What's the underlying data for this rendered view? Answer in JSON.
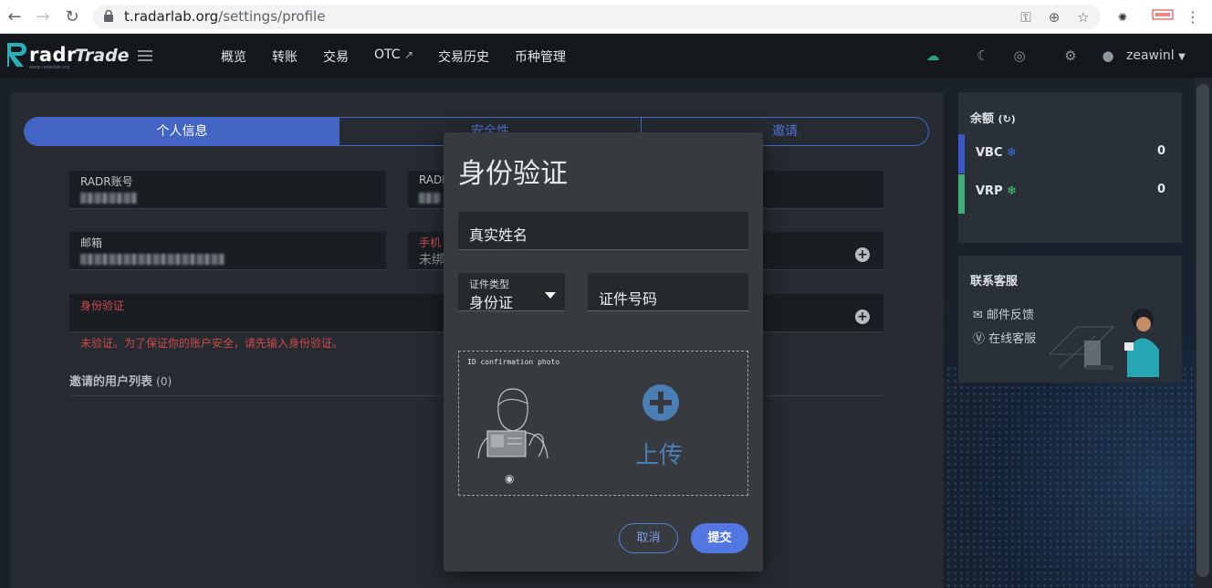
{
  "browser": {
    "url_host": "t.radarlab.org",
    "url_path": "/settings/profile"
  },
  "header": {
    "logo_word": "radr",
    "logo_trade": "Trade",
    "logo_sub": "www.radarlab.org",
    "nav": [
      "概览",
      "转账",
      "交易",
      "OTC",
      "交易历史",
      "币种管理"
    ],
    "user_name": "zeawinl"
  },
  "tabs": [
    {
      "label": "个人信息",
      "active": true
    },
    {
      "label": "安全性",
      "active": false
    },
    {
      "label": "邀请",
      "active": false
    }
  ],
  "profile": {
    "radr_account_label": "RADR账号",
    "radr_label_2": "RADR",
    "email_label": "邮箱",
    "phone_label": "手机",
    "phone_value": "未绑",
    "identity_label": "身份验证",
    "warning": "未验证。为了保证你的账户安全，请先输入身份验证。",
    "invite_title": "邀请的用户列表",
    "invite_count": "(0)"
  },
  "balance": {
    "title": "余额",
    "refresh_icon": "refresh-icon",
    "coins": [
      {
        "name": "VBC",
        "value": "0",
        "color": "#3b57c9"
      },
      {
        "name": "VRP",
        "value": "0",
        "color": "#3fb07a"
      }
    ]
  },
  "contact": {
    "title": "联系客服",
    "email_feedback": "邮件反馈",
    "online_service": "在线客服"
  },
  "modal": {
    "title": "身份验证",
    "real_name_label": "真实姓名",
    "id_type_label": "证件类型",
    "id_type_value": "身份证",
    "id_number_label": "证件号码",
    "photo_caption": "ID confirmation photo",
    "upload_label": "上传",
    "cancel_label": "取消",
    "submit_label": "提交"
  },
  "colors": {
    "accent": "#4565c4",
    "error": "#d04a4a",
    "upload": "#4b7fb3"
  }
}
